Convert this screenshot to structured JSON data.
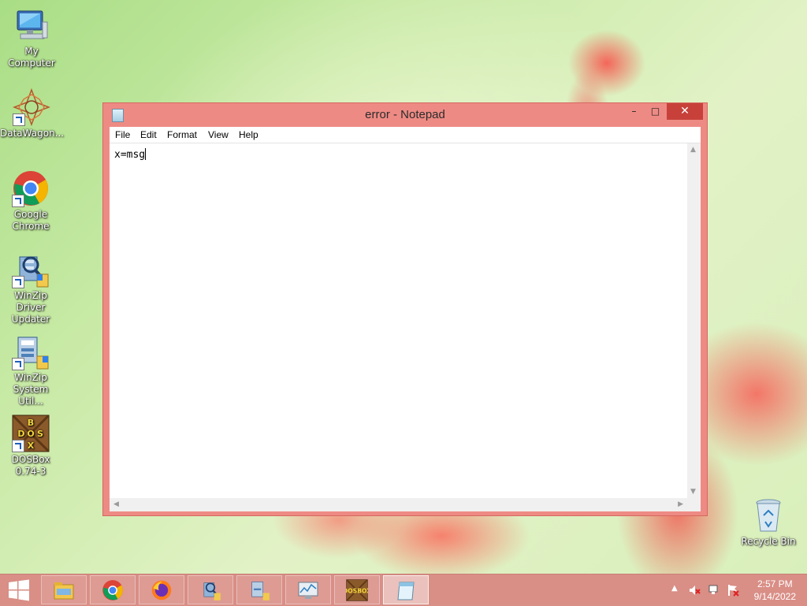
{
  "desktop": {
    "icons": [
      {
        "label": "My Computer"
      },
      {
        "label": "DataWagon..."
      },
      {
        "label": "Google Chrome"
      },
      {
        "label": "WinZip Driver Updater"
      },
      {
        "label": "WinZip System Util..."
      },
      {
        "label": "DOSBox 0.74-3"
      },
      {
        "label": "Recycle Bin"
      }
    ]
  },
  "notepad": {
    "title": "error - Notepad",
    "controls": {
      "minimize": "–",
      "maximize": "□",
      "close": "✕"
    },
    "menu": [
      "File",
      "Edit",
      "Format",
      "View",
      "Help"
    ],
    "content": "x=msg"
  },
  "taskbar": {
    "start_icon": "windows-logo-icon",
    "pinned": [
      "file-explorer-icon",
      "chrome-icon",
      "firefox-icon",
      "winzip-driver-updater-icon",
      "winzip-system-utilities-icon",
      "performance-monitor-icon",
      "dosbox-icon",
      "notepad-icon"
    ],
    "dosbox_logo_text": "DOSBOX",
    "clock": {
      "time": "2:57 PM",
      "date": "9/14/2022"
    }
  },
  "colors": {
    "window_frame": "#ee8a84",
    "close_button": "#c7413a",
    "taskbar": "#d98e86"
  }
}
